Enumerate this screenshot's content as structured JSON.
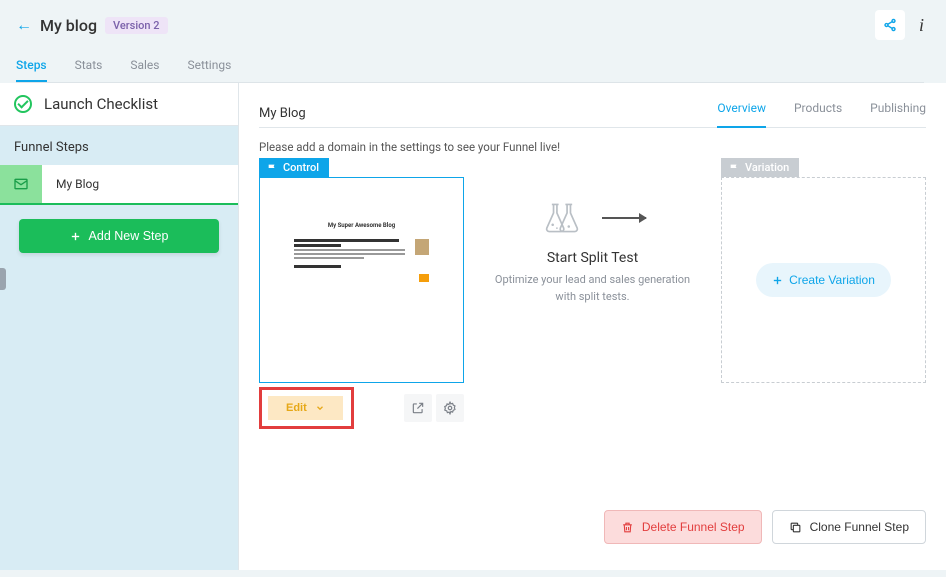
{
  "header": {
    "title": "My blog",
    "version_badge": "Version 2"
  },
  "tabs": {
    "items": [
      "Steps",
      "Stats",
      "Sales",
      "Settings"
    ],
    "active_index": 0
  },
  "sidebar": {
    "checklist_title": "Launch Checklist",
    "section_label": "Funnel Steps",
    "steps": [
      {
        "name": "My Blog"
      }
    ],
    "add_step_label": "Add New Step"
  },
  "main": {
    "step_title": "My Blog",
    "subtabs": {
      "items": [
        "Overview",
        "Products",
        "Publishing"
      ],
      "active_index": 0
    },
    "domain_note": "Please add a domain in the settings to see your Funnel live!",
    "control_label": "Control",
    "edit_label": "Edit",
    "split_test": {
      "title": "Start Split Test",
      "subtitle": "Optimize your lead and sales generation with split tests."
    },
    "variation": {
      "label": "Variation",
      "create_label": "Create Variation"
    },
    "footer": {
      "delete_label": "Delete Funnel Step",
      "clone_label": "Clone Funnel Step"
    },
    "preview_mock_title": "My Super Awesome Blog"
  }
}
